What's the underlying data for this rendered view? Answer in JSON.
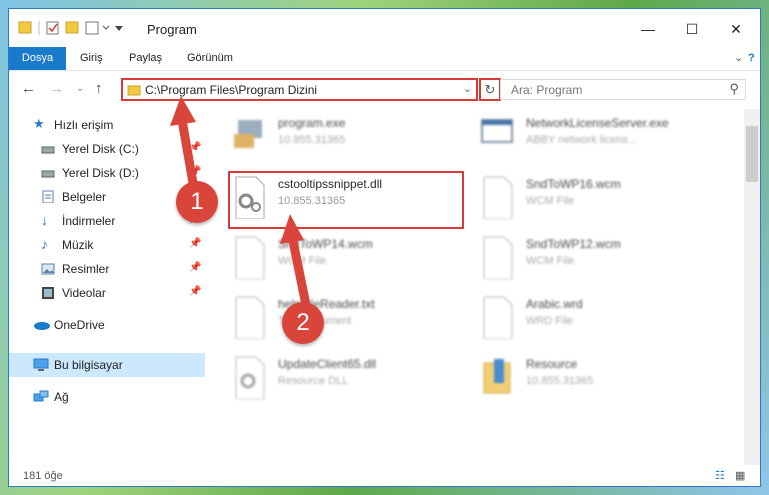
{
  "window": {
    "title": "Program",
    "controls": [
      "—",
      "☐",
      "✕"
    ]
  },
  "ribbon": {
    "tabs": [
      {
        "label": "Dosya"
      },
      {
        "label": "Giriş"
      },
      {
        "label": "Paylaş"
      },
      {
        "label": "Görünüm"
      }
    ]
  },
  "address": {
    "path": "C:\\Program Files\\Program Dizini",
    "search_placeholder": "Ara: Program"
  },
  "nav": {
    "items": [
      {
        "label": "Hızlı erişim",
        "icon": "star-icon"
      },
      {
        "label": "Yerel Disk (C:)",
        "icon": "drive-icon"
      },
      {
        "label": "Yerel Disk (D:)",
        "icon": "drive-icon"
      },
      {
        "label": "Belgeler",
        "icon": "documents-icon"
      },
      {
        "label": "İndirmeler",
        "icon": "download-icon"
      },
      {
        "label": "Müzik",
        "icon": "music-icon"
      },
      {
        "label": "Resimler",
        "icon": "pictures-icon"
      },
      {
        "label": "Videolar",
        "icon": "video-icon"
      },
      {
        "label": "OneDrive",
        "icon": "cloud-icon"
      },
      {
        "label": "Bu bilgisayar",
        "icon": "computer-icon"
      },
      {
        "label": "Ağ",
        "icon": "network-icon"
      }
    ]
  },
  "files": [
    {
      "name": "program.exe",
      "sub": "10.855.31365"
    },
    {
      "name": "NetworkLicenseServer.exe",
      "sub": "ABBY network licens..."
    },
    {
      "name": "cstooltipssnippet.dll",
      "sub": "10.855.31365"
    },
    {
      "name": "SndToWP16.wcm",
      "sub": "WCM File"
    },
    {
      "name": "SndToWP14.wcm",
      "sub": "WCM File"
    },
    {
      "name": "SndToWP12.wcm",
      "sub": "WCM File"
    },
    {
      "name": "helpFileReader.txt",
      "sub": "Text Document"
    },
    {
      "name": "Arabic.wrd",
      "sub": "WRD File"
    },
    {
      "name": "UpdateClient65.dll",
      "sub": "Resource DLL"
    },
    {
      "name": "Resource",
      "sub": "10.855.31365"
    }
  ],
  "status": {
    "count": "181 öğe"
  },
  "badges": {
    "one": "1",
    "two": "2"
  },
  "colors": {
    "accent": "#1979ca",
    "highlight": "#d93a3a"
  }
}
